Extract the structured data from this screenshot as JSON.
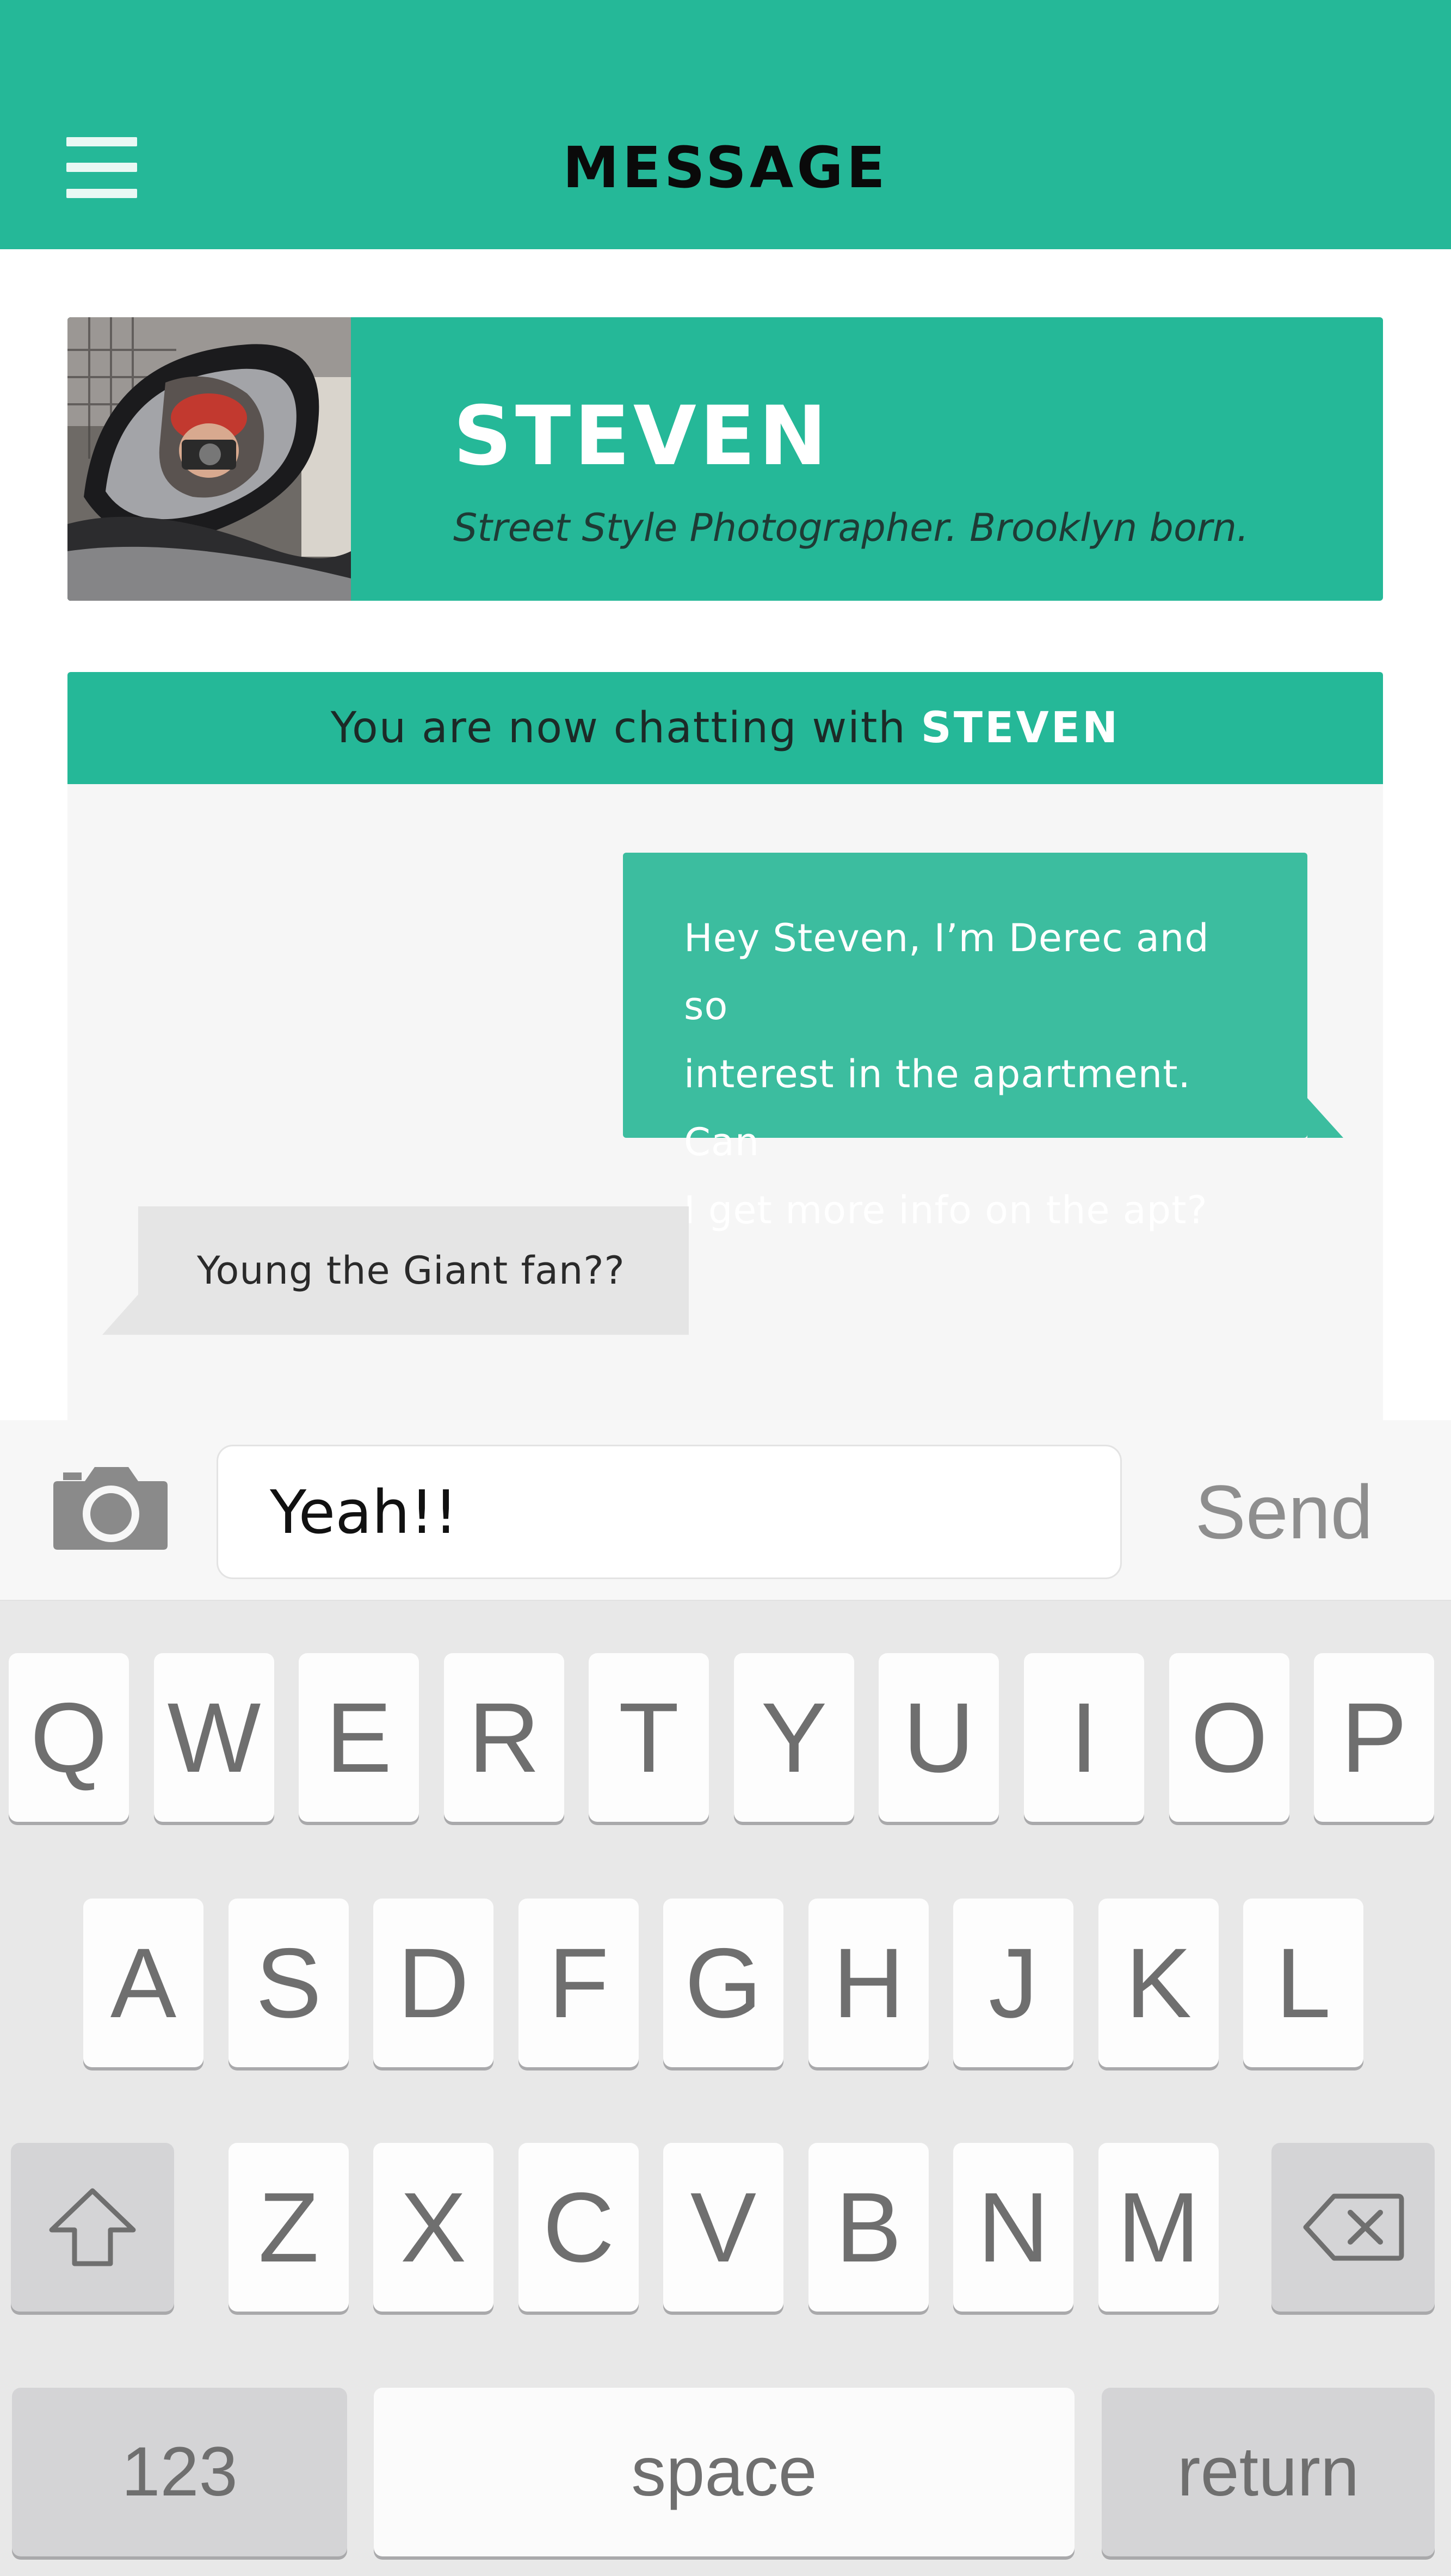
{
  "header": {
    "title": "MESSAGE",
    "menu_icon": "hamburger-menu-icon",
    "background": "#25b898"
  },
  "profile": {
    "name": "STEVEN",
    "bio": "Street Style Photographer. Brooklyn born."
  },
  "chat": {
    "banner_prefix": "You are now chatting with",
    "banner_name": "STEVEN",
    "messages": [
      {
        "direction": "outgoing",
        "lines": [
          "Hey Steven, I’m Derec and so",
          "interest in the apartment. Can",
          "I get more info on the apt?"
        ]
      },
      {
        "direction": "incoming",
        "text": "Young the Giant fan??"
      }
    ]
  },
  "composer": {
    "camera_icon": "camera-icon",
    "input_value": "Yeah!!",
    "send_label": "Send"
  },
  "keyboard": {
    "row1": [
      "Q",
      "W",
      "E",
      "R",
      "T",
      "Y",
      "U",
      "I",
      "O",
      "P"
    ],
    "row2": [
      "A",
      "S",
      "D",
      "F",
      "G",
      "H",
      "J",
      "K",
      "L"
    ],
    "row3": [
      "Z",
      "X",
      "C",
      "V",
      "B",
      "N",
      "M"
    ],
    "shift_icon": "shift-arrow-icon",
    "delete_icon": "backspace-icon",
    "numbers_label": "123",
    "space_label": "space",
    "return_label": "return"
  }
}
